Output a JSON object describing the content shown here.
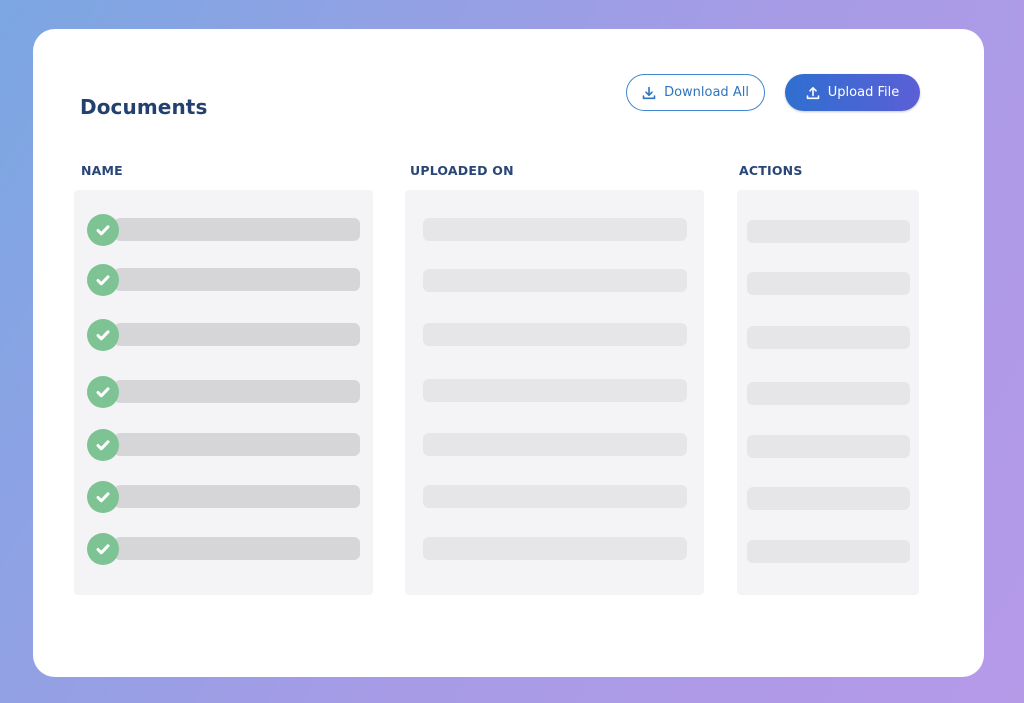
{
  "page": {
    "title": "Documents"
  },
  "toolbar": {
    "download_all_label": "Download All",
    "upload_file_label": "Upload File",
    "download_icon": "download-icon",
    "upload_icon": "upload-icon"
  },
  "table": {
    "columns": [
      "NAME",
      "UPLOADED ON",
      "ACTIONS"
    ],
    "row_count": 7,
    "rows_status": [
      "uploaded",
      "uploaded",
      "uploaded",
      "uploaded",
      "uploaded",
      "uploaded",
      "uploaded"
    ],
    "row_status_icon": "check-circle-icon"
  },
  "colors": {
    "accent": "#2f74bf",
    "title": "#24406f",
    "success": "#7ec394",
    "gradient_start": "#7ba7e2",
    "gradient_end": "#b59ae8"
  }
}
